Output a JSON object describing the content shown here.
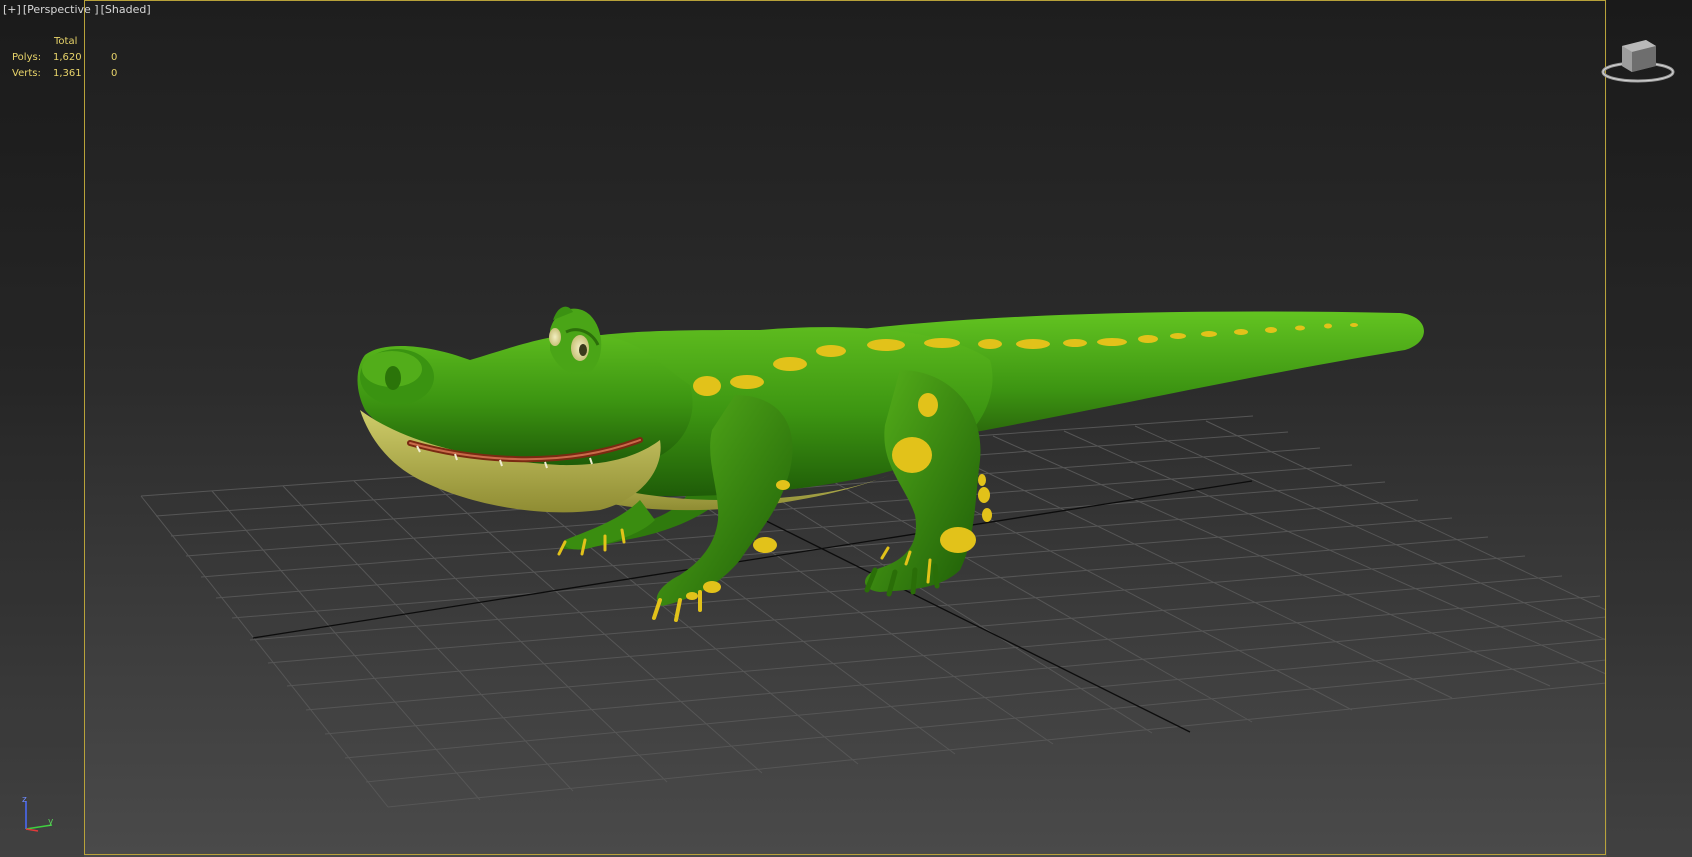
{
  "viewport": {
    "label_plus": "[+]",
    "label_view": "[Perspective ]",
    "label_shading": "[Shaded]",
    "frame_color": "#b8a23a"
  },
  "stats": {
    "header": "Total",
    "polys_label": "Polys:",
    "polys_value": "1,620",
    "polys_selected": "0",
    "verts_label": "Verts:",
    "verts_value": "1,361",
    "verts_selected": "0",
    "text_color": "#e8d46a"
  },
  "viewcube": {
    "icon": "viewcube-icon"
  },
  "axis_tripod": {
    "z": "z",
    "y": "y"
  },
  "model": {
    "icon": "crocodile-model",
    "body_color": "#3f9a12",
    "spot_color": "#e2c21a",
    "belly_color": "#b9b84e"
  }
}
